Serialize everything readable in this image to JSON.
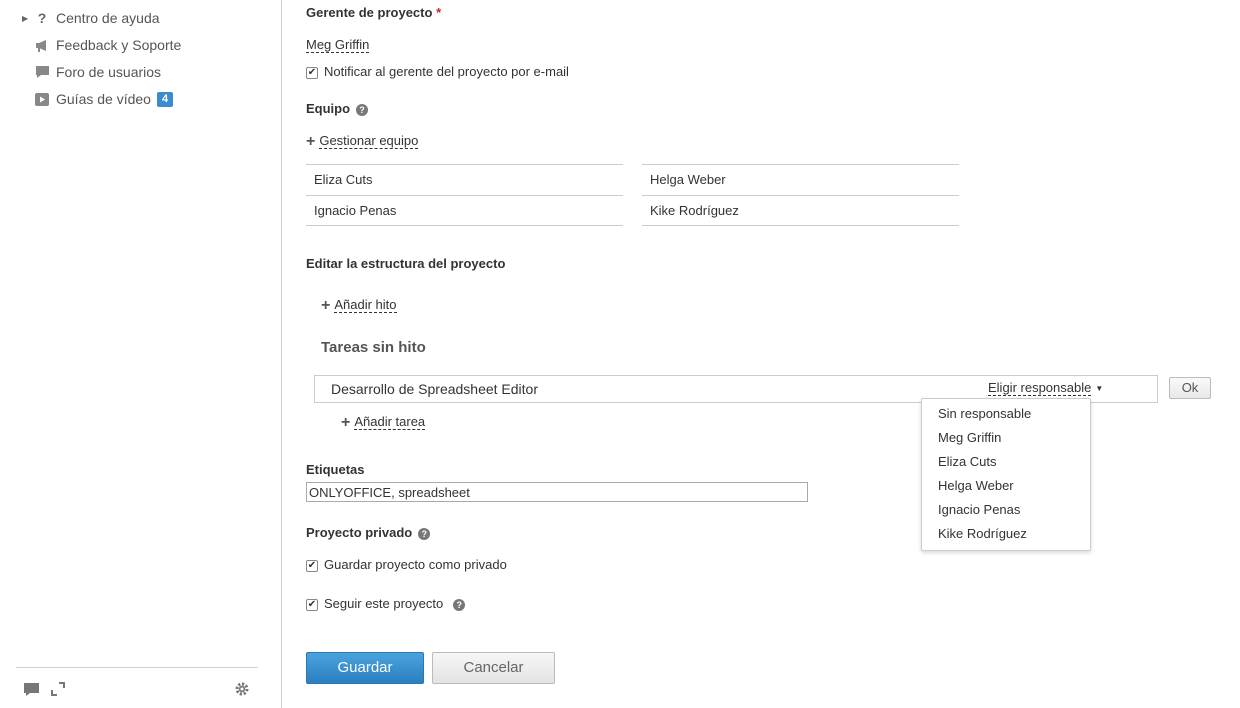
{
  "sidebar": {
    "items": [
      {
        "label": "Centro de ayuda",
        "icon": "question-icon"
      },
      {
        "label": "Feedback y Soporte",
        "icon": "megaphone-icon"
      },
      {
        "label": "Foro de usuarios",
        "icon": "chat-bubble-icon"
      },
      {
        "label": "Guías de vídeo",
        "icon": "video-icon",
        "badge": "4"
      }
    ],
    "bottom_icons": [
      "chat-icon",
      "expand-icon",
      "gear-icon"
    ]
  },
  "manager": {
    "label": "Gerente de proyecto",
    "required_mark": "*",
    "name": "Meg Griffin",
    "notify_label": "Notificar al gerente del proyecto por e-mail",
    "notify_checked": true
  },
  "team": {
    "label": "Equipo",
    "manage_label": "Gestionar equipo",
    "members": [
      "Eliza Cuts",
      "Helga Weber",
      "Ignacio Penas",
      "Kike Rodríguez"
    ]
  },
  "structure": {
    "label": "Editar la estructura del proyecto",
    "add_milestone_label": "Añadir hito",
    "no_milestone_title": "Tareas sin hito",
    "task": {
      "name": "Desarrollo de Spreadsheet Editor",
      "responsible_label": "Eligir responsable",
      "ok_label": "Ok"
    },
    "add_task_label": "Añadir tarea",
    "responsible_options": [
      "Sin responsable",
      "Meg Griffin",
      "Eliza Cuts",
      "Helga Weber",
      "Ignacio Penas",
      "Kike Rodríguez"
    ]
  },
  "tags": {
    "label": "Etiquetas",
    "value": "ONLYOFFICE, spreadsheet"
  },
  "private": {
    "label": "Proyecto privado",
    "save_private_label": "Guardar proyecto como privado",
    "save_private_checked": true,
    "follow_label": "Seguir este proyecto",
    "follow_checked": true
  },
  "actions": {
    "save_label": "Guardar",
    "cancel_label": "Cancelar"
  },
  "colors": {
    "primary_button": "#2a7fc0",
    "badge": "#3b8bcf",
    "required": "#cc2222"
  }
}
